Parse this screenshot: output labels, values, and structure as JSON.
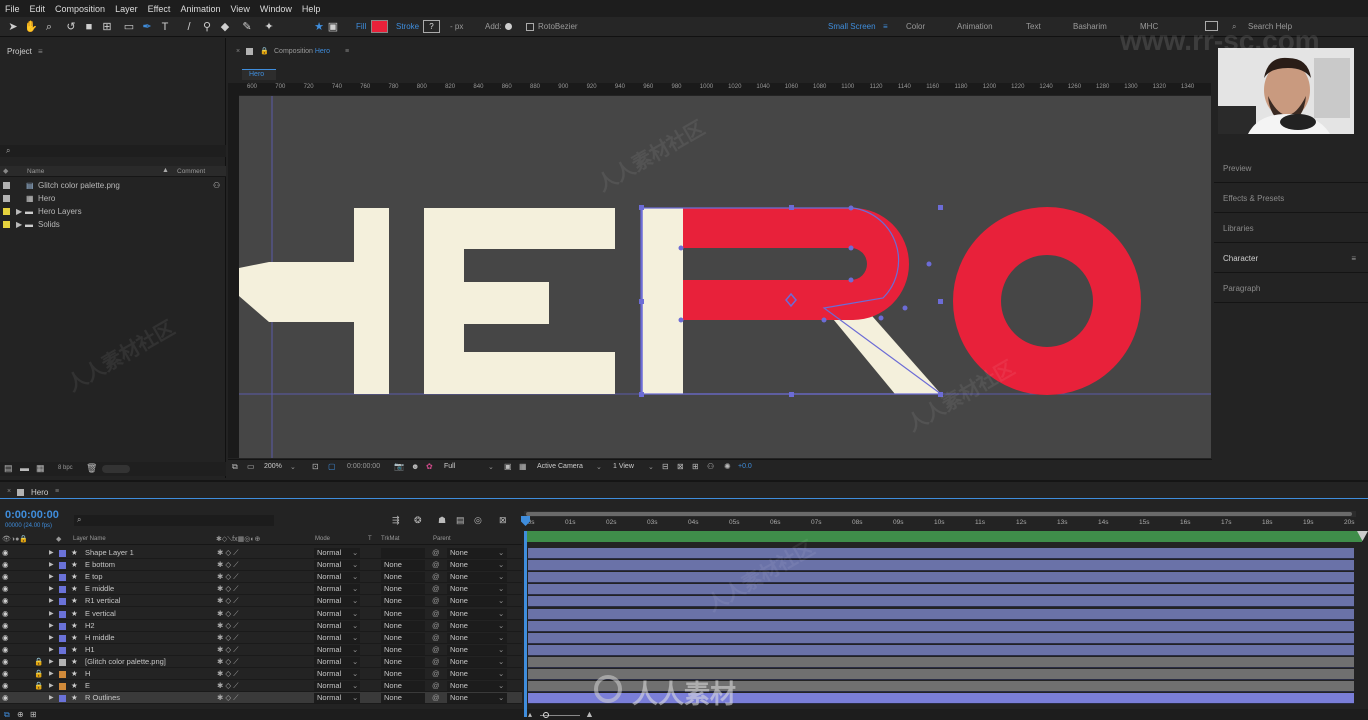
{
  "menu": [
    "File",
    "Edit",
    "Composition",
    "Layer",
    "Effect",
    "Animation",
    "View",
    "Window",
    "Help"
  ],
  "toolbar": {
    "fill_label": "Fill",
    "stroke_label": "Stroke",
    "stroke_value": "?",
    "px": "- px",
    "add_label": "Add:",
    "rotobezier": "RotoBezier",
    "workspaces": [
      "Small Screen",
      "Color",
      "Animation",
      "Text",
      "Basharim",
      "MHC"
    ],
    "search_help": "Search Help",
    "accent": "#e8213a"
  },
  "project": {
    "title": "Project",
    "col_name": "Name",
    "col_comment": "Comment",
    "items": [
      {
        "name": "Glitch color palette.png",
        "color": "#b2b2b2"
      },
      {
        "name": "Hero",
        "color": "#b2b2b2"
      },
      {
        "name": "Hero Layers",
        "color": "#e6d33e"
      },
      {
        "name": "Solids",
        "color": "#e6d33e"
      }
    ],
    "bpc": "8 bpc"
  },
  "viewer": {
    "tab_label": "Composition",
    "comp_name": "Hero",
    "breadcrumb": "Hero",
    "ruler": [
      "600",
      "700",
      "720",
      "740",
      "760",
      "780",
      "800",
      "820",
      "840",
      "860",
      "880",
      "900",
      "920",
      "940",
      "960",
      "980",
      "1000",
      "1020",
      "1040",
      "1060",
      "1080",
      "1100",
      "1120",
      "1140",
      "1160",
      "1180",
      "1200",
      "1220",
      "1240",
      "1260",
      "1280",
      "1300",
      "1320",
      "1340"
    ],
    "zoom": "200%",
    "timecode": "0:00:00:00",
    "resolution": "Full",
    "camera": "Active Camera",
    "view": "1 View",
    "exposure": "+0.0",
    "letter_cream": "#f4f0dc",
    "letter_red": "#e8213a"
  },
  "right": {
    "panels": [
      "Preview",
      "Effects & Presets",
      "Libraries",
      "Character",
      "Paragraph"
    ]
  },
  "timeline": {
    "comp_tab": "Hero",
    "timecode": "0:00:00:00",
    "frame_info": "00000 (24.00 fps)",
    "col_layer_name": "Layer Name",
    "col_mode": "Mode",
    "col_t": "T",
    "col_trkmat": "TrkMat",
    "col_parent": "Parent",
    "ticks": [
      "00s",
      "01s",
      "02s",
      "03s",
      "04s",
      "05s",
      "06s",
      "07s",
      "08s",
      "09s",
      "10s",
      "11s",
      "12s",
      "13s",
      "14s",
      "15s",
      "16s",
      "17s",
      "18s",
      "19s",
      "20s"
    ],
    "layers": [
      {
        "name": "Shape Layer 1",
        "mode": "Normal",
        "trkmat": "",
        "parent": "None",
        "color": "#6a72d8",
        "locked": false
      },
      {
        "name": "E bottom",
        "mode": "Normal",
        "trkmat": "None",
        "parent": "None",
        "color": "#6a72d8",
        "locked": false
      },
      {
        "name": "E top",
        "mode": "Normal",
        "trkmat": "None",
        "parent": "None",
        "color": "#6a72d8",
        "locked": false
      },
      {
        "name": "E middle",
        "mode": "Normal",
        "trkmat": "None",
        "parent": "None",
        "color": "#6a72d8",
        "locked": false
      },
      {
        "name": "R1 vertical",
        "mode": "Normal",
        "trkmat": "None",
        "parent": "None",
        "color": "#6a72d8",
        "locked": false
      },
      {
        "name": "E vertical",
        "mode": "Normal",
        "trkmat": "None",
        "parent": "None",
        "color": "#6a72d8",
        "locked": false
      },
      {
        "name": "H2",
        "mode": "Normal",
        "trkmat": "None",
        "parent": "None",
        "color": "#6a72d8",
        "locked": false
      },
      {
        "name": "H middle",
        "mode": "Normal",
        "trkmat": "None",
        "parent": "None",
        "color": "#6a72d8",
        "locked": false
      },
      {
        "name": "H1",
        "mode": "Normal",
        "trkmat": "None",
        "parent": "None",
        "color": "#6a72d8",
        "locked": false
      },
      {
        "name": "[Glitch color palette.png]",
        "mode": "Normal",
        "trkmat": "None",
        "parent": "None",
        "color": "#b2b2b2",
        "locked": true
      },
      {
        "name": "H",
        "mode": "Normal",
        "trkmat": "None",
        "parent": "None",
        "color": "#d08a3a",
        "locked": true
      },
      {
        "name": "E",
        "mode": "Normal",
        "trkmat": "None",
        "parent": "None",
        "color": "#d08a3a",
        "locked": true
      },
      {
        "name": "R Outlines",
        "mode": "Normal",
        "trkmat": "None",
        "parent": "None",
        "color": "#6a72d8",
        "locked": false
      }
    ]
  },
  "watermark": {
    "site": "www.rr-sc.com",
    "cn": "人人素材社区",
    "logo": "人人素材"
  }
}
